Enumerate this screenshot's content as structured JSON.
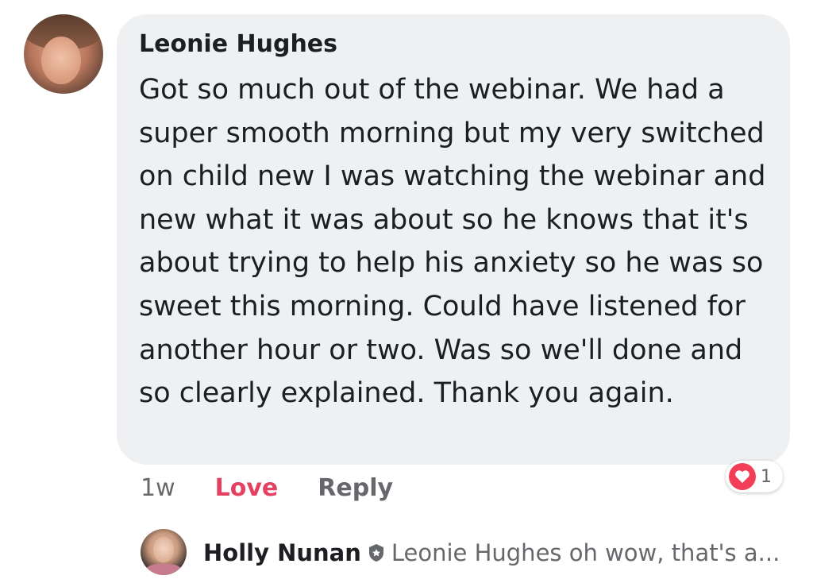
{
  "comment": {
    "author": "Leonie Hughes",
    "text": "Got so much out of the webinar. We had a super smooth morning but my very switched on child new I was watching the webinar and new what it was about so he knows that it's about trying to help his anxiety so he was so sweet this morning. Could have listened for another hour or two. Was so we'll done and so clearly explained. Thank you again.",
    "time": "1w",
    "love_label": "Love",
    "reply_label": "Reply",
    "reaction_icon": "heart-icon",
    "reaction_count": "1",
    "colors": {
      "bubble": "#eff0f2",
      "love": "#e4405f",
      "reaction": "#f33e58",
      "muted": "#65676b"
    }
  },
  "reply": {
    "author": "Holly Nunan",
    "badge_icon": "shield-badge-icon",
    "preview": "Leonie Hughes oh wow, that's a..."
  }
}
